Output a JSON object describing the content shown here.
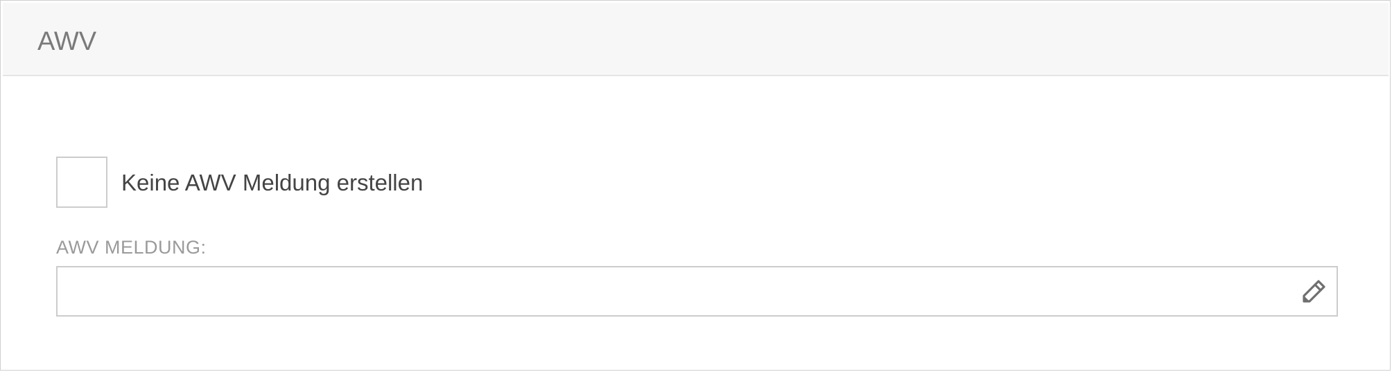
{
  "panel": {
    "title": "AWV"
  },
  "checkbox": {
    "label": "Keine AWV Meldung erstellen",
    "checked": false
  },
  "field": {
    "label": "AWV MELDUNG:",
    "value": "",
    "edit_icon": "pencil-icon"
  },
  "colors": {
    "header_bg": "#f7f7f7",
    "border": "#cccccc",
    "title_text": "#7a7a7a",
    "label_text": "#9a9a9a",
    "body_text": "#444444",
    "icon": "#6f6f6f"
  }
}
